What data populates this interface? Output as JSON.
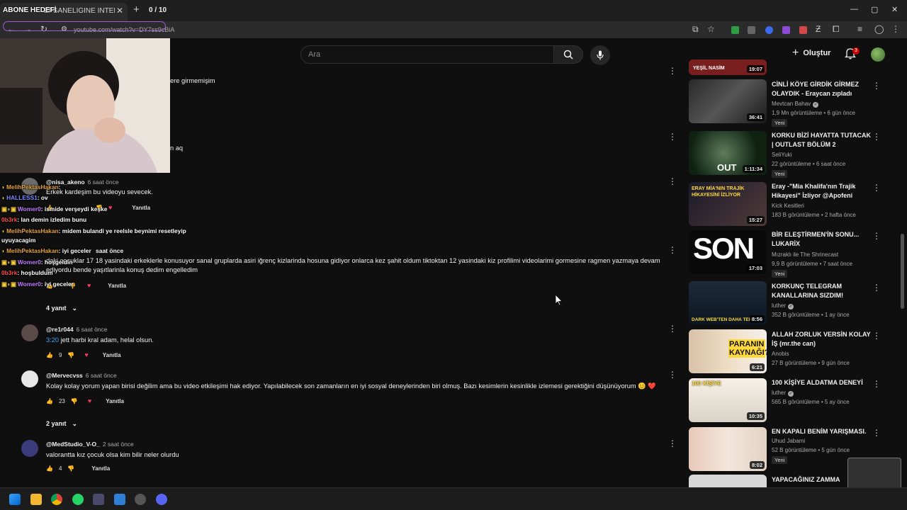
{
  "overlay": {
    "abone_label": "ABONE HEDEFİ",
    "abone_counter": "0 / 10"
  },
  "browser": {
    "tab_title": "EFSANELİĞİNE İNTERNETTE",
    "url": "youtube.com/watch?v=DY7ss9cBiA"
  },
  "header": {
    "search_placeholder": "Ara",
    "create_label": "Oluştur",
    "notif_count": "3"
  },
  "comments": [
    {
      "author": "",
      "time": "",
      "text": "ere girmemişim",
      "likes": "",
      "reply": ""
    },
    {
      "author": "",
      "time": "",
      "text": "n aq",
      "likes": "",
      "reply": ""
    },
    {
      "author": "@nisa_akeno",
      "time": "6 saat önce",
      "text": "Erkek kardeşim bu videoyu sevecek.",
      "likes": "",
      "reply": "Yanıtla"
    },
    {
      "author": "",
      "time": "saat önce",
      "text": "daki cocuklar 17 18 yasindaki erkeklerle konusuyor sanal gruplarda asiri iğrenç kizlarindа hosuna gidiyor onlarca kez şahit oldum tiktoktan 12 yasindaki kiz profilimi videolarimi gormesine ragmen yazmaya devam ediyordu bende yaşıtlarinla konuş dedim engelledim",
      "likes": "",
      "reply": "Yanıtla",
      "replies": "4 yanıt"
    },
    {
      "author": "@re1r044",
      "time": "6 saat önce",
      "link": "3:20",
      "text": " jett harbi kral adam, helal olsun.",
      "likes": "9",
      "reply": "Yanıtla"
    },
    {
      "author": "@Mervecvss",
      "time": "6 saat önce",
      "text": "Kolay kolay yorum yapan birisi değilim ama bu video etkileşimi hak ediyor. Yapılabilecek son zamanların en iyi sosyal deneylerinden biri olmuş. Bazı kesimlerin kesinlikle izlemesi gerektiğini düşünüyorum 😊 ❤️",
      "likes": "23",
      "reply": "Yanıtla",
      "replies": "2 yanıt"
    },
    {
      "author": "@MedStudio_V-O_",
      "time": "2 saat önce",
      "text": "valorantta kız çocuk olsa kim bilir neler olurdu",
      "likes": "4",
      "reply": "Yanıtla"
    }
  ],
  "chat": [
    {
      "user": "MelihPektasHakan",
      "msg": ":",
      "color": "#e6a23c"
    },
    {
      "user": "HALLESS1",
      "msg": ": ov",
      "color": "#7f8cff"
    },
    {
      "user": "Womer0",
      "msg": ": ismide verşeydi keşke",
      "color": "#c27cff"
    },
    {
      "user": "0b3rk",
      "msg": ": lan demin izledim bunu",
      "color": "#ff4d4d"
    },
    {
      "user": "MelihPektasHakan",
      "msg": ": midem bulandi ye reelsle beynimi resetleyip",
      "color": "#e6a23c"
    },
    {
      "user": "",
      "msg": "uyuyacagim",
      "color": "#ffffff"
    },
    {
      "user": "MelihPektasHakan",
      "msg": ": iyi geceler",
      "color": "#e6a23c"
    },
    {
      "user": "Womer0",
      "msg": ": hoşgeldin",
      "color": "#c27cff"
    },
    {
      "user": "0b3rk",
      "msg": ": hoşbuldum",
      "color": "#ff4d4d"
    },
    {
      "user": "Womer0",
      "msg": ": iyi geceler",
      "color": "#c27cff"
    }
  ],
  "sidebar": [
    {
      "title": "",
      "channel": "",
      "meta": "",
      "duration": "19:07",
      "thumb_label": "YEŞİL NASİM",
      "badge": "",
      "verified": false
    },
    {
      "title": "CİNLİ KÖYE GİRDİK GİRMEZ OLAYDIK - Eraycan zıpladı",
      "channel": "Mevtcan Bahav",
      "meta": "1,9 Mn görüntüleme • 6 gün önce",
      "duration": "36:41",
      "thumb_label": "",
      "badge": "Yeni",
      "verified": true
    },
    {
      "title": "KORKU BİZİ HAYATTA TUTACAK | OUTLAST BÖLÜM 2",
      "channel": "SeliYuki",
      "meta": "22 görüntüleme • 6 saat önce",
      "duration": "1:11:34",
      "thumb_label": "OUT",
      "badge": "Yeni",
      "verified": false
    },
    {
      "title": "Eray -\"Mia Khalifa'nın Trajik Hikayesi\" İzliyor @Apofeni",
      "channel": "Kick Kesitleri",
      "meta": "183 B görüntüleme • 2 hafta önce",
      "duration": "15:27",
      "thumb_label": "ERAY MİA'NIN TRAJİK HİKAYESİNİ İZLİYOR",
      "badge": "",
      "verified": false
    },
    {
      "title": "BİR ELEŞTİRMEN'İN SONU... LUKARİX",
      "channel": "Mızraklı ile The Shrinecast",
      "meta": "9,9 B görüntüleme • 7 saat önce",
      "duration": "17:03",
      "thumb_label": "SON",
      "badge": "Yeni",
      "verified": false
    },
    {
      "title": "KORKUNÇ TELEGRAM KANALLARINA SIZDIM!",
      "channel": "luther",
      "meta": "352 B görüntüleme • 1 ay önce",
      "duration": "8:56",
      "thumb_label": "DARK WEB'TEN DAHA TEH",
      "badge": "",
      "verified": true
    },
    {
      "title": "ALLAH ZORLUK VERSİN KOLAY İŞ (mr.the can)",
      "channel": "Anobis",
      "meta": "27 B görüntüleme • 9 gün önce",
      "duration": "6:21",
      "thumb_label": "PARANIN KAYNAĞI?",
      "badge": "",
      "verified": false
    },
    {
      "title": "100 KİŞİYE ALDATMA DENEYİ",
      "channel": "luther",
      "meta": "565 B görüntüleme • 5 ay önce",
      "duration": "10:35",
      "thumb_label": "100 KİŞİYE",
      "badge": "",
      "verified": true
    },
    {
      "title": "EN KAPALI BENİM YARIŞMASI.",
      "channel": "Uhud Jabami",
      "meta": "52 B görüntüleme • 5 gün önce",
      "duration": "8:02",
      "thumb_label": "",
      "badge": "Yeni",
      "verified": false
    },
    {
      "title": "YAPACAĞINIZ ZAMMA",
      "channel": "",
      "meta": "",
      "duration": "",
      "thumb_label": "",
      "badge": "",
      "verified": false
    }
  ],
  "colors": {
    "accent_red": "#cc0000",
    "link_blue": "#3ea6ff",
    "overlay_purple": "#a259d9"
  }
}
